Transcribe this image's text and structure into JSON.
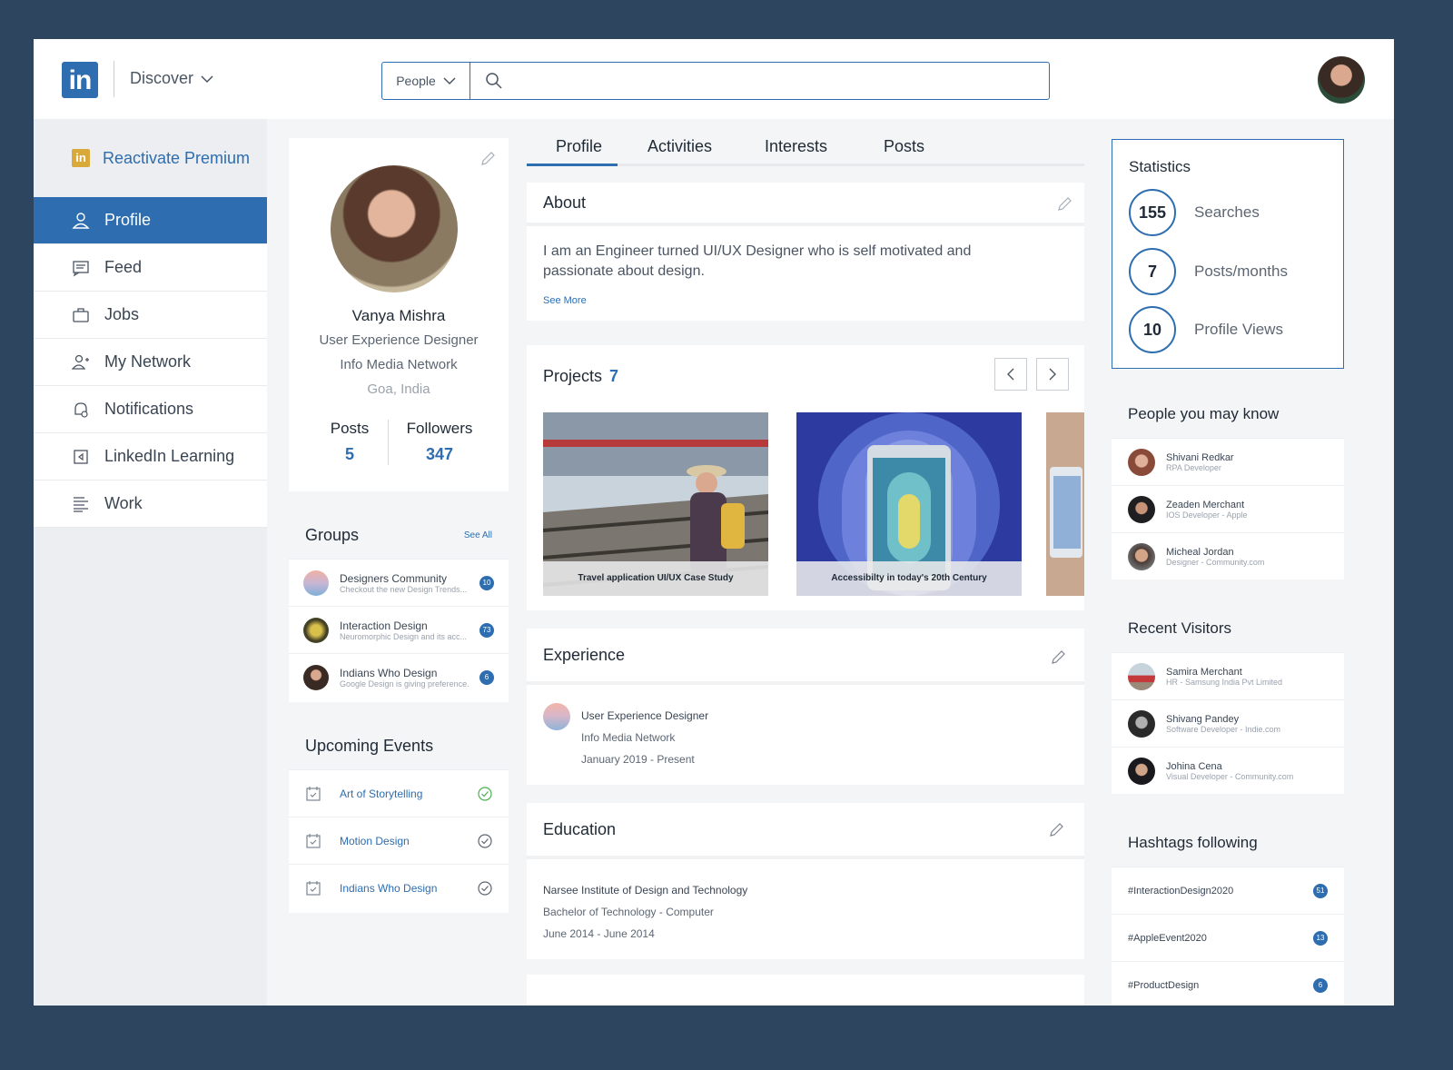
{
  "header": {
    "logo": "in",
    "discover_label": "Discover",
    "search_filter": "People",
    "search_placeholder": ""
  },
  "sidebar": {
    "premium": "Reactivate Premium",
    "items": [
      {
        "label": "Profile",
        "icon": "user-icon",
        "active": true
      },
      {
        "label": "Feed",
        "icon": "feed-icon"
      },
      {
        "label": "Jobs",
        "icon": "briefcase-icon"
      },
      {
        "label": "My Network",
        "icon": "add-user-icon"
      },
      {
        "label": "Notifications",
        "icon": "bell-icon"
      },
      {
        "label": "LinkedIn Learning",
        "icon": "learning-icon"
      },
      {
        "label": "Work",
        "icon": "work-icon"
      }
    ]
  },
  "profile": {
    "name": "Vanya Mishra",
    "title": "User Experience Designer",
    "company": "Info Media Network",
    "location": "Goa, India",
    "posts_label": "Posts",
    "posts": "5",
    "followers_label": "Followers",
    "followers": "347"
  },
  "groups": {
    "title": "Groups",
    "see_all": "See All",
    "items": [
      {
        "title": "Designers Community",
        "sub": "Checkout the new Design Trends...",
        "count": "10"
      },
      {
        "title": "Interaction Design",
        "sub": "Neuromorphic Design and its acc...",
        "count": "73"
      },
      {
        "title": "Indians Who Design",
        "sub": "Google Design is giving preference...",
        "count": "6"
      }
    ]
  },
  "events": {
    "title": "Upcoming Events",
    "items": [
      {
        "title": "Art of Storytelling",
        "done": true
      },
      {
        "title": "Motion Design",
        "done": false
      },
      {
        "title": "Indians Who Design",
        "done": false
      }
    ]
  },
  "tabs": [
    "Profile",
    "Activities",
    "Interests",
    "Posts"
  ],
  "about": {
    "title": "About",
    "text": "I am an Engineer turned UI/UX Designer who is self motivated and passionate about design.",
    "see_more": "See More"
  },
  "projects": {
    "title": "Projects",
    "count": "7",
    "items": [
      {
        "caption": "Travel application UI/UX Case Study"
      },
      {
        "caption": "Accessibilty in today's 20th Century"
      }
    ]
  },
  "experience": {
    "title": "Experience",
    "role": "User Experience Designer",
    "company": "Info Media Network",
    "dates": "January 2019 - Present"
  },
  "education": {
    "title": "Education",
    "school": "Narsee Institute of Design and Technology",
    "degree": "Bachelor of Technology - Computer",
    "dates": "June 2014 - June 2014"
  },
  "statistics": {
    "title": "Statistics",
    "items": [
      {
        "value": "155",
        "label": "Searches"
      },
      {
        "value": "7",
        "label": "Posts/months"
      },
      {
        "value": "10",
        "label": "Profile Views"
      }
    ]
  },
  "people": {
    "title": "People you may know",
    "items": [
      {
        "name": "Shivani Redkar",
        "sub": "RPA Developer"
      },
      {
        "name": "Zeaden Merchant",
        "sub": "IOS Developer - Apple"
      },
      {
        "name": "Micheal Jordan",
        "sub": "Designer - Community.com"
      }
    ]
  },
  "visitors": {
    "title": "Recent Visitors",
    "items": [
      {
        "name": "Samira Merchant",
        "sub": "HR - Samsung India Pvt Limited"
      },
      {
        "name": "Shivang Pandey",
        "sub": "Software Developer - Indie.com"
      },
      {
        "name": "Johina Cena",
        "sub": "Visual Developer - Community.com"
      }
    ]
  },
  "hashtags": {
    "title": "Hashtags following",
    "items": [
      {
        "tag": "#InteractionDesign2020",
        "count": "51"
      },
      {
        "tag": "#AppleEvent2020",
        "count": "13"
      },
      {
        "tag": "#ProductDesign",
        "count": "6"
      }
    ]
  },
  "colors": {
    "accent": "#2d6db0",
    "background": "#2e4560",
    "premium": "#d9a93a"
  }
}
